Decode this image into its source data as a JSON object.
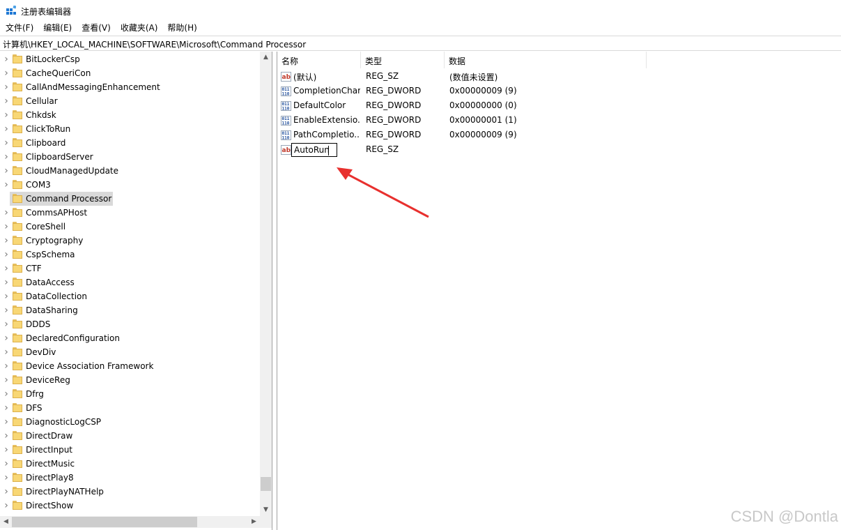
{
  "window": {
    "title": "注册表编辑器"
  },
  "menu": [
    "文件(F)",
    "编辑(E)",
    "查看(V)",
    "收藏夹(A)",
    "帮助(H)"
  ],
  "address": "计算机\\HKEY_LOCAL_MACHINE\\SOFTWARE\\Microsoft\\Command Processor",
  "tree": {
    "items": [
      "BitLockerCsp",
      "CacheQueriCon",
      "CallAndMessagingEnhancement",
      "Cellular",
      "Chkdsk",
      "ClickToRun",
      "Clipboard",
      "ClipboardServer",
      "CloudManagedUpdate",
      "COM3",
      "Command Processor",
      "CommsAPHost",
      "CoreShell",
      "Cryptography",
      "CspSchema",
      "CTF",
      "DataAccess",
      "DataCollection",
      "DataSharing",
      "DDDS",
      "DeclaredConfiguration",
      "DevDiv",
      "Device Association Framework",
      "DeviceReg",
      "Dfrg",
      "DFS",
      "DiagnosticLogCSP",
      "DirectDraw",
      "DirectInput",
      "DirectMusic",
      "DirectPlay8",
      "DirectPlayNATHelp",
      "DirectShow"
    ],
    "selected": "Command Processor"
  },
  "list": {
    "columns": [
      "名称",
      "类型",
      "数据"
    ],
    "rows": [
      {
        "icon": "string-value-icon",
        "name": "(默认)",
        "type": "REG_SZ",
        "data": "(数值未设置)"
      },
      {
        "icon": "dword-value-icon",
        "name": "CompletionChar",
        "type": "REG_DWORD",
        "data": "0x00000009 (9)"
      },
      {
        "icon": "dword-value-icon",
        "name": "DefaultColor",
        "type": "REG_DWORD",
        "data": "0x00000000 (0)"
      },
      {
        "icon": "dword-value-icon",
        "name": "EnableExtensio...",
        "type": "REG_DWORD",
        "data": "0x00000001 (1)"
      },
      {
        "icon": "dword-value-icon",
        "name": "PathCompletio...",
        "type": "REG_DWORD",
        "data": "0x00000009 (9)"
      },
      {
        "icon": "string-value-icon",
        "name": "AutoRun",
        "type": "REG_SZ",
        "data": ""
      }
    ],
    "editing_row": "AutoRun"
  },
  "annotation": {
    "arrow_color": "#e8302e"
  },
  "watermark": "CSDN @Dontla"
}
